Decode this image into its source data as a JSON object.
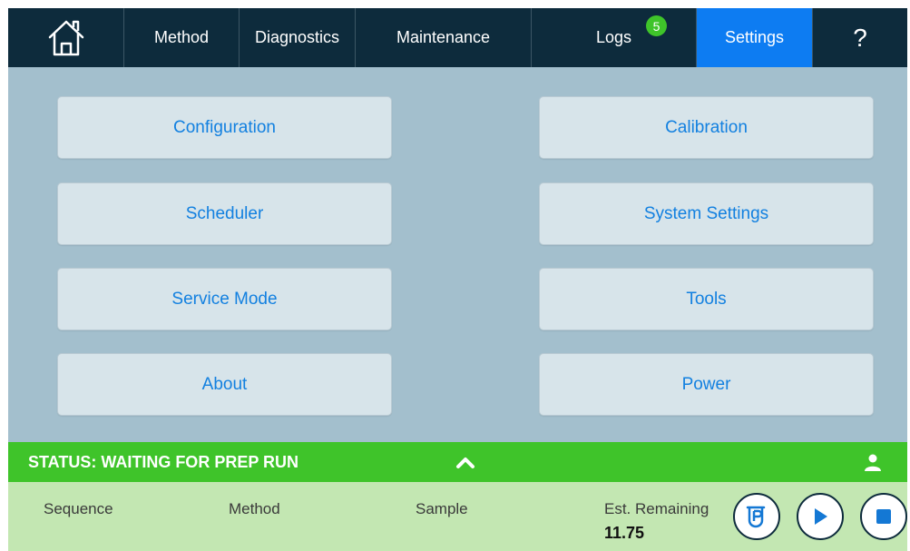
{
  "nav": {
    "home_icon": "home-icon",
    "items": [
      {
        "label": "Method"
      },
      {
        "label": "Diagnostics"
      },
      {
        "label": "Maintenance"
      },
      {
        "label": "Logs",
        "badge": "5"
      },
      {
        "label": "Settings",
        "active": true
      },
      {
        "label": "?"
      }
    ]
  },
  "settings_tiles": {
    "configuration": "Configuration",
    "calibration": "Calibration",
    "scheduler": "Scheduler",
    "system_settings": "System Settings",
    "service_mode": "Service Mode",
    "tools": "Tools",
    "about": "About",
    "power": "Power"
  },
  "status": {
    "text": "STATUS: WAITING FOR PREP RUN",
    "chevron_icon": "chevron-up-icon",
    "user_icon": "user-icon"
  },
  "info": {
    "sequence_label": "Sequence",
    "method_label": "Method",
    "sample_label": "Sample",
    "remaining_label": "Est. Remaining",
    "remaining_value": "11.75"
  },
  "controls": {
    "prep_icon": "prep-vial-icon",
    "play_icon": "play-icon",
    "stop_icon": "stop-icon"
  },
  "colors": {
    "nav_bg": "#0d2b3c",
    "active_tab": "#0d7cf2",
    "panel_bg": "#a3bfcd",
    "tile_bg": "#d7e4ea",
    "tile_text": "#1280e0",
    "status_green": "#3fc42a",
    "info_bg": "#c3e7b2"
  }
}
